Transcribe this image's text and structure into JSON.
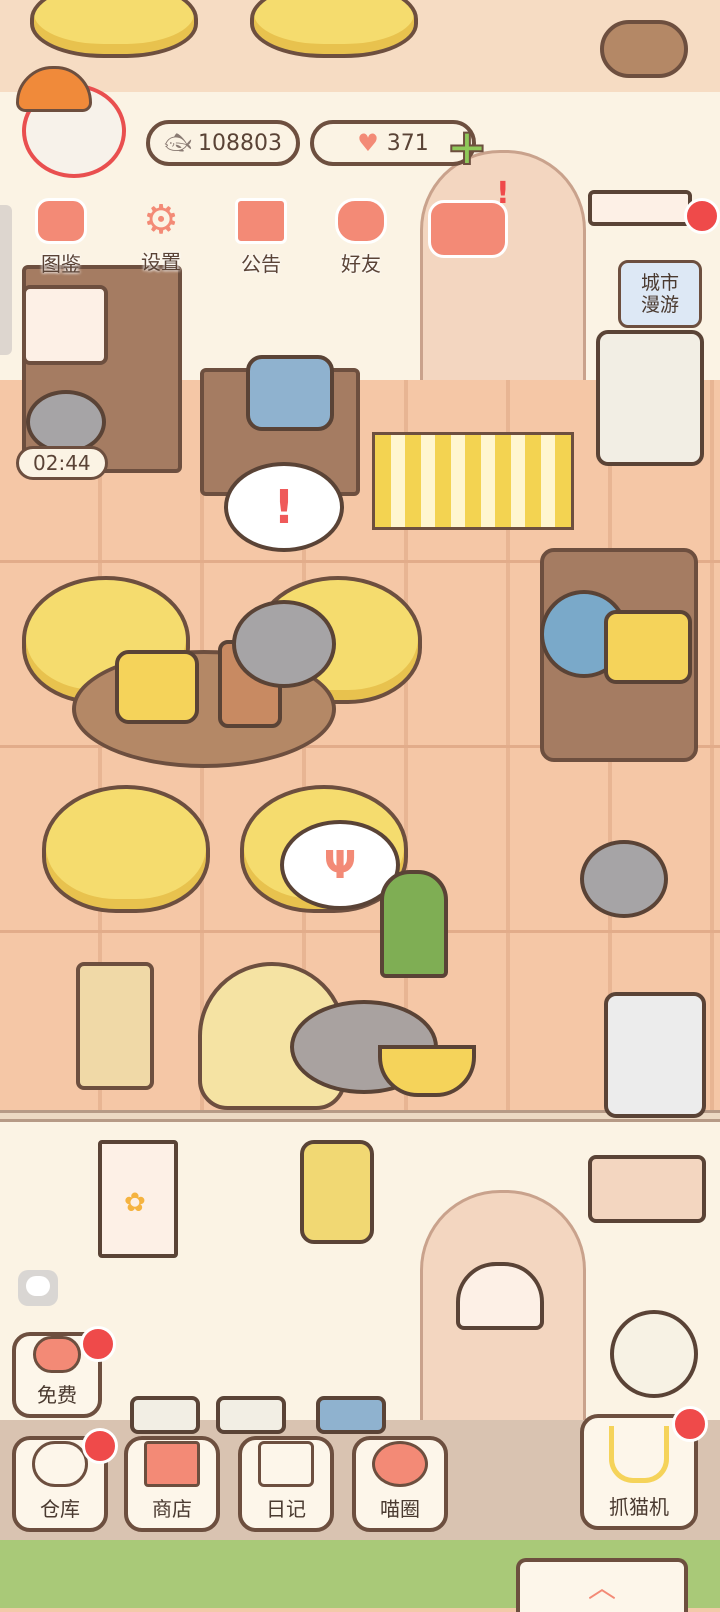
{
  "hud": {
    "fish_count": "108803",
    "heart_count": "371"
  },
  "top_menu": [
    {
      "id": "collection",
      "label": "图鉴",
      "icon": "cat-head-icon"
    },
    {
      "id": "settings",
      "label": "设置",
      "icon": "gear-icon"
    },
    {
      "id": "announcement",
      "label": "公告",
      "icon": "gift-icon"
    },
    {
      "id": "friends",
      "label": "好友",
      "icon": "friends-icon"
    }
  ],
  "city_roam": {
    "line1": "城市",
    "line2": "漫游"
  },
  "timer": "02:44",
  "bottom_menu": {
    "free": "免费",
    "warehouse": "仓库",
    "shop": "商店",
    "diary": "日记",
    "meow_circle": "喵圈",
    "claw_machine": "抓猫机"
  },
  "colors": {
    "outline": "#6d4f3f",
    "accent": "#f38a76",
    "badge": "#ef4a4a",
    "floor": "#f5c7a6",
    "wall": "#fbf3e4"
  }
}
